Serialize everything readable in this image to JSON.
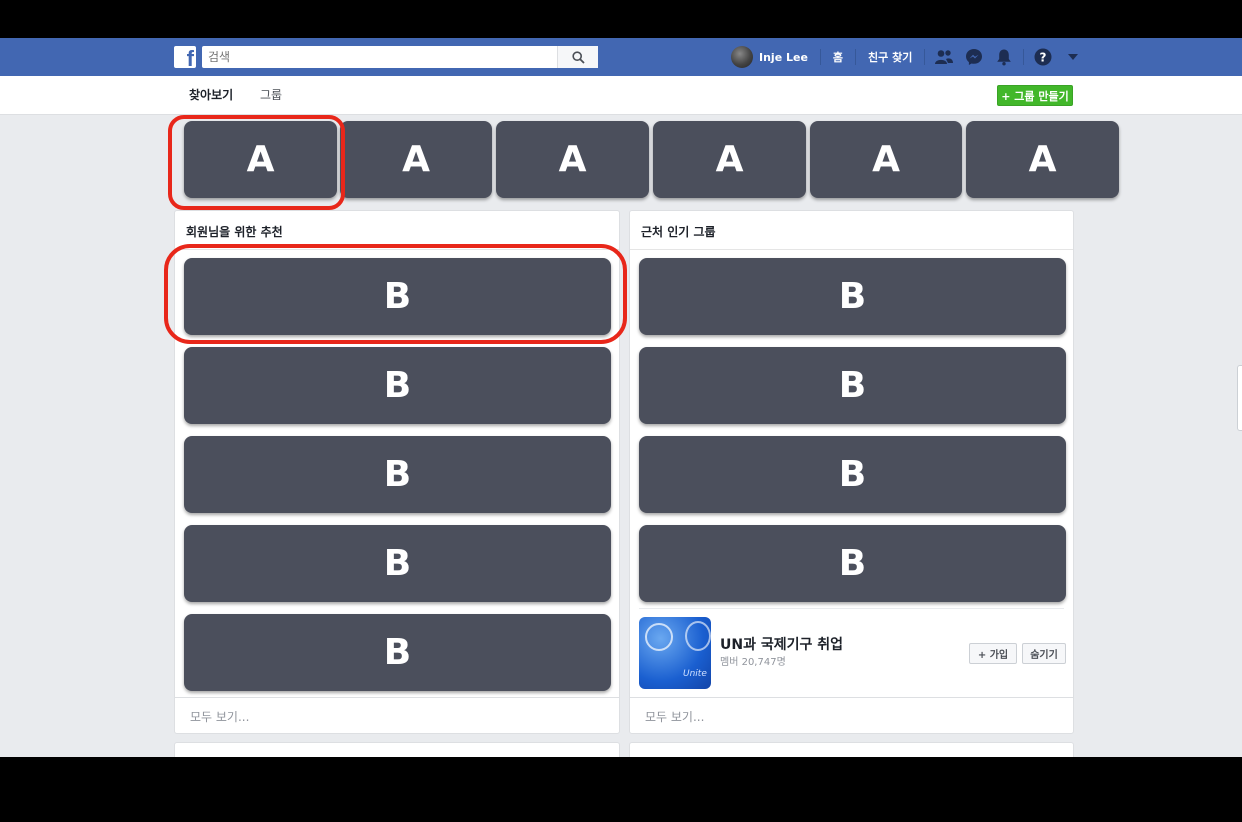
{
  "search": {
    "placeholder": "검색"
  },
  "profile": {
    "name": "Inje Lee"
  },
  "nav": {
    "home": "홈",
    "find_friends": "친구 찾기"
  },
  "subnav": {
    "tabs": [
      "찾아보기",
      "그룹"
    ],
    "create_group": "+ 그룹 만들기"
  },
  "categories": [
    "A",
    "A",
    "A",
    "A",
    "A",
    "A"
  ],
  "recommended": {
    "title": "회원님을 위한 추천",
    "items": [
      "B",
      "B",
      "B",
      "B",
      "B"
    ],
    "see_all": "모두 보기..."
  },
  "nearby": {
    "title": "근처 인기 그룹",
    "items": [
      "B",
      "B",
      "B",
      "B"
    ],
    "group": {
      "name": "UN과 국제기구 취업",
      "members": "멤버 20,747명",
      "image_text": "Unite",
      "join": "+ 가입",
      "hide": "숨기기"
    },
    "see_all": "모두 보기..."
  },
  "colors": {
    "brand": "#4267b2",
    "create_button": "#42b72a",
    "placeholder_box": "#4b4f5c",
    "annotation": "#e8271a"
  }
}
